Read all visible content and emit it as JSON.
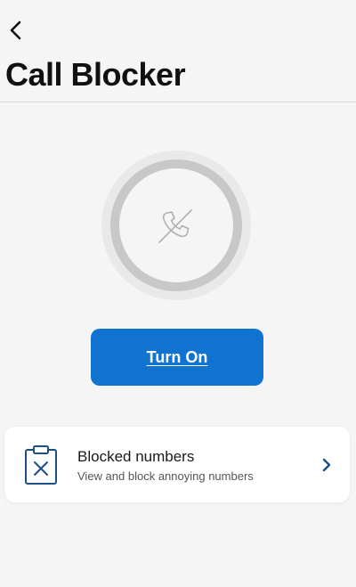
{
  "header": {
    "back_icon": "chevron-left-icon",
    "title": "Call Blocker"
  },
  "status": {
    "icon": "phone-slash-icon",
    "ring_color": "#c8c8c8"
  },
  "action": {
    "turn_on_label": "Turn On",
    "accent": "#1173d0"
  },
  "blocked_numbers": {
    "icon": "clipboard-x-icon",
    "title": "Blocked numbers",
    "subtitle": "View and block annoying numbers",
    "chevron_icon": "chevron-right-icon"
  }
}
